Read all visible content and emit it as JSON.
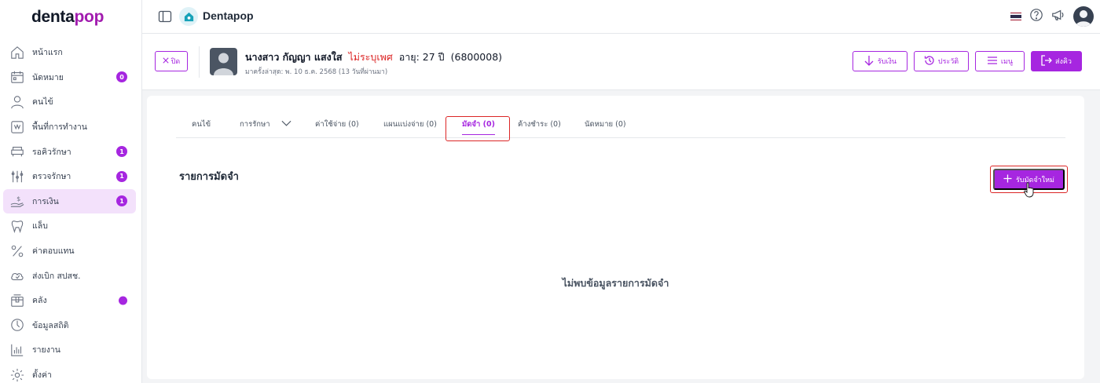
{
  "brand": {
    "logo_dark": "denta",
    "logo_accent": "pop",
    "app_title": "Dentapop"
  },
  "colors": {
    "accent": "#a626e0",
    "highlight": "#dc2626",
    "gender": "#dc2626"
  },
  "sidebar": {
    "items": [
      {
        "label": "หน้าแรก",
        "icon": "home-icon"
      },
      {
        "label": "นัดหมาย",
        "icon": "calendar-icon",
        "badge": "0"
      },
      {
        "label": "คนไข้",
        "icon": "user-icon"
      },
      {
        "label": "พื้นที่การทำงาน",
        "icon": "workspace-icon"
      },
      {
        "label": "รอคิวรักษา",
        "icon": "dental-chair-icon",
        "badge": "1"
      },
      {
        "label": "ตรวจรักษา",
        "icon": "tools-icon",
        "badge": "1"
      },
      {
        "label": "การเงิน",
        "icon": "money-hand-icon",
        "badge": "1",
        "active": true
      },
      {
        "label": "แล็บ",
        "icon": "tooth-icon"
      },
      {
        "label": "ค่าตอบแทน",
        "icon": "percent-icon"
      },
      {
        "label": "ส่งเบิก สปสช.",
        "icon": "cloud-icon"
      },
      {
        "label": "คลัง",
        "icon": "box-icon",
        "dot": true
      },
      {
        "label": "ข้อมูลสถิติ",
        "icon": "stats-icon"
      },
      {
        "label": "รายงาน",
        "icon": "report-icon"
      },
      {
        "label": "ตั้งค่า",
        "icon": "gear-icon"
      }
    ]
  },
  "patient": {
    "close_label": "ปิด",
    "name": "นางสาว กัญญา แสงใส",
    "gender": "ไม่ระบุเพศ",
    "age": "อายุ: 27 ปี",
    "hn": "(6800008)",
    "last_visit": "มาครั้งล่าสุด: พ. 10 ธ.ค. 2568 (13 วันที่ผ่านมา)"
  },
  "actions": {
    "receive": "รับเงิน",
    "history": "ประวัติ",
    "menu": "เมนู",
    "send": "ส่งคิว"
  },
  "tabs": [
    {
      "label": "คนไข้"
    },
    {
      "label": "การรักษา"
    },
    {
      "label": "ค่าใช้จ่าย (0)"
    },
    {
      "label": "แผนแบ่งจ่าย (0)"
    },
    {
      "label": "มัดจำ (0)",
      "active": true
    },
    {
      "label": "ค้างชำระ (0)"
    },
    {
      "label": "นัดหมาย (0)"
    }
  ],
  "deposit": {
    "title": "รายการมัดจำ",
    "new_button": "รับมัดจำใหม่",
    "empty": "ไม่พบข้อมูลรายการมัดจำ"
  }
}
